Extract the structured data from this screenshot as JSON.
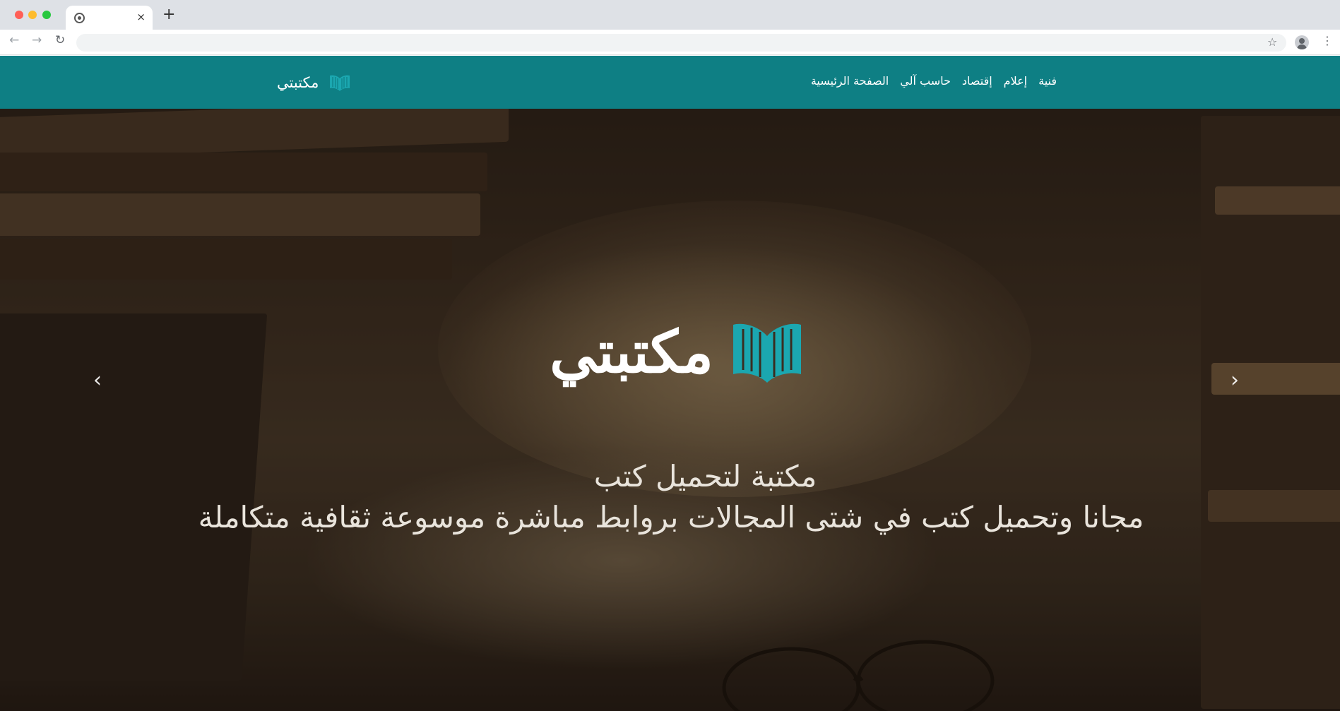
{
  "browser": {
    "tab_close": "×",
    "new_tab": "+",
    "back": "←",
    "forward": "→",
    "reload": "↻",
    "url": "",
    "star": "☆",
    "menu": "⋮",
    "icons": [
      "favicon-icon",
      "close-icon",
      "plus-icon",
      "back-arrow-icon",
      "forward-arrow-icon",
      "reload-icon",
      "star-icon",
      "profile-icon",
      "menu-icon"
    ]
  },
  "navbar": {
    "brand": "مكتبتي",
    "links": [
      "الصفحة الرئيسية",
      "حاسب آلي",
      "إقتصاد",
      "إعلام",
      "فنية"
    ],
    "background": "#0e7f84"
  },
  "hero": {
    "brand": "مكتبتي",
    "tagline_line1": "مكتبة لتحميل كتب",
    "tagline_line2": "مجانا وتحميل كتب في شتى المجالات بروابط مباشرة موسوعة ثقافية متكاملة",
    "prev_arrow": "‹",
    "next_arrow": "›",
    "logo_color": "#1ba7b0"
  }
}
